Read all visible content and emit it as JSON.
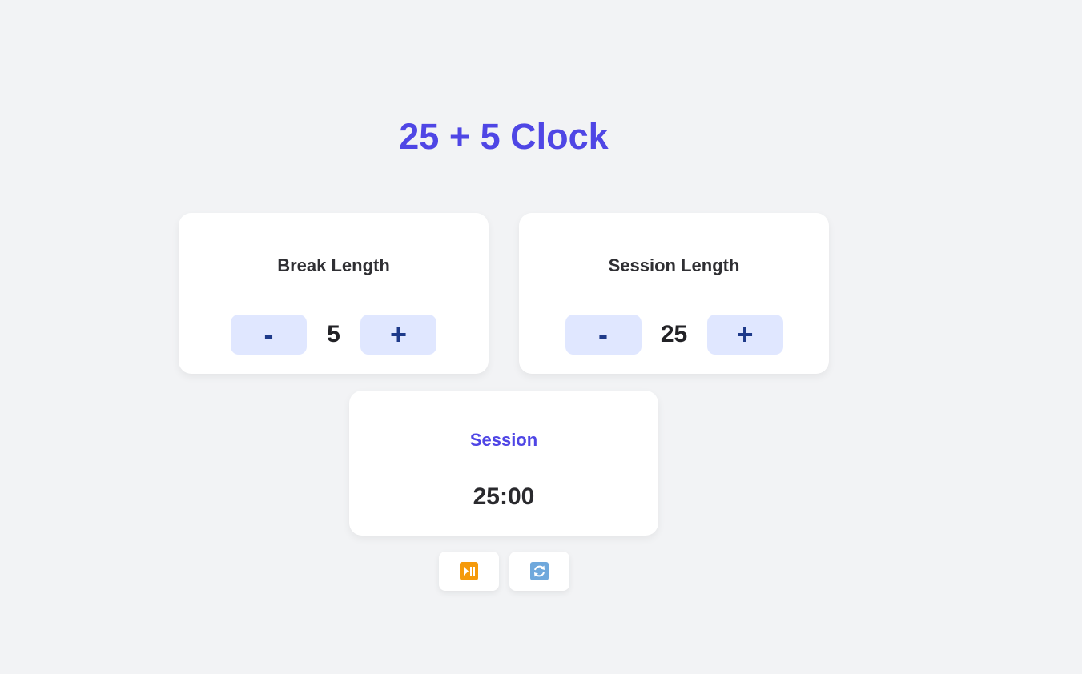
{
  "header": {
    "title": "25 + 5 Clock"
  },
  "break": {
    "label": "Break Length",
    "decrement": "-",
    "value": "5",
    "increment": "+"
  },
  "session": {
    "label": "Session Length",
    "decrement": "-",
    "value": "25",
    "increment": "+"
  },
  "timer": {
    "label": "Session",
    "time_left": "25:00"
  },
  "actions": {
    "start_stop_icon": "play-pause-icon",
    "reset_icon": "refresh-icon"
  },
  "colors": {
    "accent": "#4f46e5",
    "stepper_bg": "#e0e7ff",
    "stepper_text": "#1e3a8a",
    "play_pause": "#f59a0b",
    "refresh": "#6fa8dc"
  }
}
